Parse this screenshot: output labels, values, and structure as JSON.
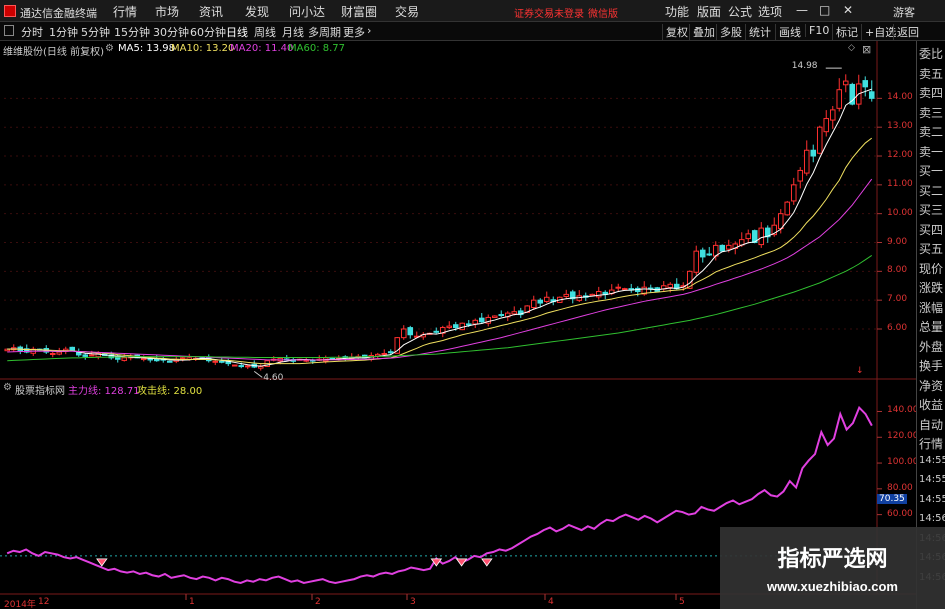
{
  "app": {
    "title": "通达信金融终端",
    "menus": [
      "行情",
      "市场",
      "资讯",
      "发现",
      "问小达",
      "财富圈",
      "交易"
    ],
    "notice": "证券交易未登录",
    "notice2": "微信版",
    "right_menus": [
      "功能",
      "版面",
      "公式",
      "选项"
    ],
    "guest": "游客",
    "win_min": "—",
    "win_max": "□",
    "win_close": "✕"
  },
  "toolbar": {
    "periods": [
      "分时",
      "1分钟",
      "5分钟",
      "15分钟",
      "30分钟",
      "60分钟",
      "日线",
      "周线",
      "月线",
      "多周期",
      "更多"
    ],
    "active_period": "日线",
    "right_buttons": [
      "复权",
      "叠加",
      "多股",
      "统计",
      "画线",
      "F10",
      "标记",
      "+自选",
      "返回"
    ]
  },
  "sidebar": [
    "委比",
    "卖五",
    "卖四",
    "卖三",
    "卖二",
    "卖一",
    "买一",
    "买二",
    "买三",
    "买四",
    "买五",
    "现价",
    "涨跌",
    "涨幅",
    "总量",
    "外盘",
    "换手",
    "净资",
    "收益",
    "自动",
    "行情",
    "14:55",
    "14:55",
    "14:55",
    "14:56",
    "14:56",
    "14:56",
    "14:56"
  ],
  "main_panel": {
    "stock_name": "维维股份(日线 前复权)",
    "ma": [
      {
        "label": "MA5: 13.98",
        "color": "#ffffff"
      },
      {
        "label": "MA10: 13.20",
        "color": "#f0e060"
      },
      {
        "label": "MA20: 11.40",
        "color": "#e040e0"
      },
      {
        "label": "MA60: 8.77",
        "color": "#30c030"
      }
    ]
  },
  "sub_panel": {
    "name": "股票指标网",
    "line1": "主力线: 128.71",
    "line1_color": "#e040e0",
    "line2": "攻击线: 28.00",
    "line2_color": "#e0e040"
  },
  "watermark": {
    "title": "指标严选网",
    "url": "www.xuezhibiao.com"
  },
  "chart_data": [
    {
      "type": "candlestick",
      "title": "维维股份(日线 前复权)",
      "y_ticks": [
        6.0,
        7.0,
        8.0,
        9.0,
        10.0,
        11.0,
        12.0,
        13.0,
        14.0
      ],
      "ylim": [
        4.3,
        15.4
      ],
      "annotations": [
        {
          "label": "14.98",
          "value": 14.98
        },
        {
          "label": "4.60",
          "value": 4.6
        }
      ],
      "close": [
        5.3,
        5.35,
        5.25,
        5.2,
        5.3,
        5.28,
        5.2,
        5.15,
        5.2,
        5.3,
        5.25,
        5.1,
        5.05,
        5.1,
        5.15,
        5.08,
        5.0,
        4.95,
        5.0,
        5.05,
        5.0,
        4.98,
        4.95,
        4.9,
        4.92,
        4.88,
        4.95,
        5.0,
        5.0,
        4.98,
        4.95,
        4.9,
        4.88,
        4.85,
        4.8,
        4.75,
        4.7,
        4.72,
        4.68,
        4.7,
        4.9,
        4.95,
        4.98,
        4.92,
        4.88,
        4.95,
        4.92,
        4.9,
        4.95,
        5.0,
        4.95,
        4.98,
        5.0,
        5.02,
        5.05,
        5.0,
        5.08,
        5.12,
        5.15,
        5.2,
        5.7,
        6.0,
        5.8,
        5.75,
        5.8,
        5.85,
        5.9,
        6.05,
        6.1,
        6.05,
        6.2,
        6.15,
        6.3,
        6.25,
        6.4,
        6.45,
        6.5,
        6.55,
        6.6,
        6.5,
        6.8,
        7.0,
        6.9,
        7.1,
        6.95,
        7.1,
        7.2,
        7.05,
        7.15,
        7.1,
        7.2,
        7.3,
        7.2,
        7.35,
        7.45,
        7.4,
        7.35,
        7.3,
        7.45,
        7.4,
        7.3,
        7.5,
        7.55,
        7.4,
        7.5,
        8.0,
        8.7,
        8.5,
        8.6,
        8.9,
        8.7,
        8.9,
        8.95,
        9.1,
        9.3,
        9.0,
        9.5,
        9.2,
        9.6,
        10.0,
        10.4,
        11.0,
        11.5,
        12.2,
        12.0,
        13.0,
        13.3,
        13.6,
        14.3,
        14.6,
        13.8,
        14.5,
        14.4,
        14.0
      ],
      "series": [
        {
          "name": "MA5",
          "values": [
            5.3,
            5.31,
            5.3,
            5.28,
            5.28,
            5.28,
            5.25,
            5.23,
            5.22,
            5.23,
            5.24,
            5.2,
            5.16,
            5.14,
            5.13,
            5.1,
            5.08,
            5.06,
            5.04,
            5.02,
            5.01,
            5.0,
            4.98,
            4.97,
            4.95,
            4.93,
            4.92,
            4.92,
            4.93,
            4.96,
            4.98,
            4.97,
            4.94,
            4.91,
            4.88,
            4.84,
            4.8,
            4.76,
            4.73,
            4.71,
            4.75,
            4.79,
            4.85,
            4.88,
            4.93,
            4.94,
            4.94,
            4.93,
            4.92,
            4.94,
            4.94,
            4.96,
            4.98,
            4.99,
            5.0,
            5.0,
            5.03,
            5.05,
            5.08,
            5.11,
            5.25,
            5.45,
            5.57,
            5.69,
            5.81,
            5.84,
            5.82,
            5.87,
            5.94,
            5.99,
            6.06,
            6.11,
            6.16,
            6.19,
            6.26,
            6.31,
            6.38,
            6.43,
            6.5,
            6.52,
            6.59,
            6.69,
            6.76,
            6.86,
            6.95,
            7.01,
            7.05,
            7.08,
            7.09,
            7.12,
            7.14,
            7.17,
            7.19,
            7.23,
            7.3,
            7.34,
            7.35,
            7.37,
            7.39,
            7.38,
            7.36,
            7.39,
            7.42,
            7.41,
            7.45,
            7.59,
            7.83,
            8.02,
            8.26,
            8.54,
            8.68,
            8.72,
            8.81,
            8.91,
            8.99,
            9.02,
            9.17,
            9.22,
            9.32,
            9.46,
            9.74,
            10.04,
            10.5,
            11.02,
            11.42,
            11.94,
            12.4,
            12.82,
            13.24,
            13.76,
            13.92,
            14.16,
            14.24,
            14.32
          ],
          "color": "#ffffff"
        },
        {
          "name": "MA10",
          "values": [
            5.3,
            5.3,
            5.3,
            5.29,
            5.29,
            5.28,
            5.27,
            5.26,
            5.25,
            5.25,
            5.24,
            5.22,
            5.21,
            5.19,
            5.18,
            5.16,
            5.14,
            5.11,
            5.09,
            5.07,
            5.05,
            5.03,
            5.01,
            4.99,
            4.98,
            4.96,
            4.95,
            4.94,
            4.94,
            4.94,
            4.94,
            4.94,
            4.93,
            4.92,
            4.91,
            4.89,
            4.87,
            4.84,
            4.82,
            4.8,
            4.8,
            4.8,
            4.8,
            4.8,
            4.8,
            4.8,
            4.81,
            4.83,
            4.84,
            4.86,
            4.87,
            4.88,
            4.89,
            4.9,
            4.91,
            4.92,
            4.94,
            4.96,
            4.98,
            5.0,
            5.06,
            5.15,
            5.24,
            5.33,
            5.43,
            5.5,
            5.55,
            5.6,
            5.67,
            5.73,
            5.8,
            5.85,
            5.9,
            5.95,
            6.01,
            6.06,
            6.12,
            6.17,
            6.23,
            6.28,
            6.34,
            6.4,
            6.47,
            6.55,
            6.61,
            6.67,
            6.73,
            6.79,
            6.84,
            6.89,
            6.93,
            6.97,
            7.0,
            7.04,
            7.09,
            7.13,
            7.17,
            7.2,
            7.24,
            7.26,
            7.28,
            7.3,
            7.33,
            7.35,
            7.37,
            7.47,
            7.61,
            7.72,
            7.84,
            7.98,
            8.07,
            8.15,
            8.24,
            8.31,
            8.39,
            8.47,
            8.56,
            8.64,
            8.72,
            8.83,
            8.99,
            9.18,
            9.41,
            9.69,
            9.92,
            10.2,
            10.5,
            10.85,
            11.16,
            11.6,
            11.93,
            12.2,
            12.45,
            12.62
          ],
          "color": "#f0e060"
        },
        {
          "name": "MA20",
          "values": [
            5.2,
            5.21,
            5.22,
            5.22,
            5.23,
            5.23,
            5.23,
            5.23,
            5.23,
            5.23,
            5.23,
            5.22,
            5.21,
            5.2,
            5.19,
            5.18,
            5.17,
            5.16,
            5.15,
            5.14,
            5.13,
            5.12,
            5.11,
            5.1,
            5.09,
            5.08,
            5.07,
            5.06,
            5.05,
            5.04,
            5.03,
            5.02,
            5.01,
            5.0,
            4.99,
            4.98,
            4.97,
            4.96,
            4.95,
            4.94,
            4.93,
            4.93,
            4.93,
            4.93,
            4.93,
            4.93,
            4.93,
            4.93,
            4.93,
            4.93,
            4.93,
            4.93,
            4.94,
            4.94,
            4.95,
            4.95,
            4.96,
            4.97,
            4.98,
            4.99,
            5.01,
            5.04,
            5.07,
            5.1,
            5.14,
            5.18,
            5.22,
            5.26,
            5.3,
            5.35,
            5.4,
            5.45,
            5.5,
            5.55,
            5.6,
            5.65,
            5.7,
            5.76,
            5.82,
            5.88,
            5.94,
            6.0,
            6.06,
            6.12,
            6.18,
            6.24,
            6.3,
            6.36,
            6.42,
            6.48,
            6.54,
            6.6,
            6.66,
            6.71,
            6.76,
            6.81,
            6.86,
            6.91,
            6.96,
            7.0,
            7.04,
            7.08,
            7.12,
            7.16,
            7.2,
            7.26,
            7.33,
            7.4,
            7.47,
            7.55,
            7.62,
            7.69,
            7.77,
            7.84,
            7.92,
            8.0,
            8.08,
            8.17,
            8.26,
            8.36,
            8.47,
            8.6,
            8.75,
            8.9,
            9.05,
            9.2,
            9.4,
            9.6,
            9.8,
            10.05,
            10.3,
            10.6,
            10.9,
            11.2
          ],
          "color": "#e040e0"
        },
        {
          "name": "MA60",
          "values": [
            4.9,
            4.91,
            4.92,
            4.93,
            4.94,
            4.95,
            4.96,
            4.97,
            4.98,
            4.99,
            5.0,
            5.0,
            5.01,
            5.01,
            5.02,
            5.02,
            5.03,
            5.03,
            5.03,
            5.04,
            5.04,
            5.04,
            5.04,
            5.04,
            5.04,
            5.04,
            5.04,
            5.04,
            5.04,
            5.04,
            5.04,
            5.04,
            5.03,
            5.03,
            5.03,
            5.02,
            5.02,
            5.02,
            5.01,
            5.01,
            5.01,
            5.01,
            5.01,
            5.01,
            5.01,
            5.01,
            5.01,
            5.01,
            5.01,
            5.01,
            5.02,
            5.02,
            5.02,
            5.03,
            5.03,
            5.04,
            5.04,
            5.05,
            5.05,
            5.06,
            5.07,
            5.08,
            5.09,
            5.1,
            5.11,
            5.12,
            5.13,
            5.15,
            5.17,
            5.19,
            5.21,
            5.23,
            5.25,
            5.27,
            5.29,
            5.31,
            5.33,
            5.35,
            5.38,
            5.41,
            5.44,
            5.47,
            5.5,
            5.53,
            5.56,
            5.59,
            5.62,
            5.65,
            5.68,
            5.71,
            5.74,
            5.77,
            5.8,
            5.83,
            5.86,
            5.9,
            5.94,
            5.98,
            6.02,
            6.06,
            6.1,
            6.14,
            6.18,
            6.22,
            6.26,
            6.3,
            6.35,
            6.4,
            6.45,
            6.5,
            6.56,
            6.62,
            6.68,
            6.74,
            6.8,
            6.86,
            6.93,
            7.0,
            7.07,
            7.14,
            7.21,
            7.28,
            7.36,
            7.44,
            7.52,
            7.6,
            7.7,
            7.8,
            7.9,
            8.0,
            8.12,
            8.25,
            8.4,
            8.55
          ],
          "color": "#30c030"
        }
      ]
    },
    {
      "type": "line",
      "title": "股票指标网",
      "y_ticks": [
        60.0,
        80.0,
        100.0,
        120.0,
        140.0
      ],
      "ylim": [
        44,
        152
      ],
      "current_value_label": "70.35",
      "reference_line": 28,
      "x_tick_labels": [
        "2014年",
        "12",
        "1",
        "2",
        "3",
        "4",
        "5"
      ],
      "series": [
        {
          "name": "主力线",
          "color": "#e040e0",
          "values": [
            30,
            32,
            31,
            33,
            30,
            28,
            31,
            30,
            29,
            27,
            26,
            27,
            25,
            23,
            21,
            19,
            17,
            18,
            16,
            15,
            16,
            14,
            15,
            13,
            12,
            14,
            11,
            12,
            13,
            11,
            10,
            12,
            11,
            9,
            11,
            10,
            8,
            7,
            9,
            8,
            10,
            9,
            11,
            12,
            10,
            8,
            9,
            7,
            8,
            9,
            10,
            8,
            7,
            8,
            9,
            10,
            12,
            13,
            12,
            14,
            15,
            14,
            16,
            17,
            19,
            18,
            17,
            18,
            26,
            22,
            24,
            27,
            23,
            25,
            28,
            27,
            30,
            31,
            33,
            32,
            34,
            37,
            40,
            43,
            45,
            48,
            50,
            47,
            49,
            52,
            50,
            48,
            51,
            49,
            53,
            56,
            55,
            58,
            60,
            58,
            56,
            59,
            57,
            54,
            57,
            60,
            63,
            62,
            60,
            61,
            66,
            64,
            63,
            66,
            69,
            71,
            68,
            70,
            72,
            76,
            79,
            75,
            74,
            78,
            86,
            81,
            96,
            102,
            107,
            124,
            114,
            119,
            138,
            126,
            131,
            143,
            138,
            129
          ]
        }
      ]
    }
  ]
}
